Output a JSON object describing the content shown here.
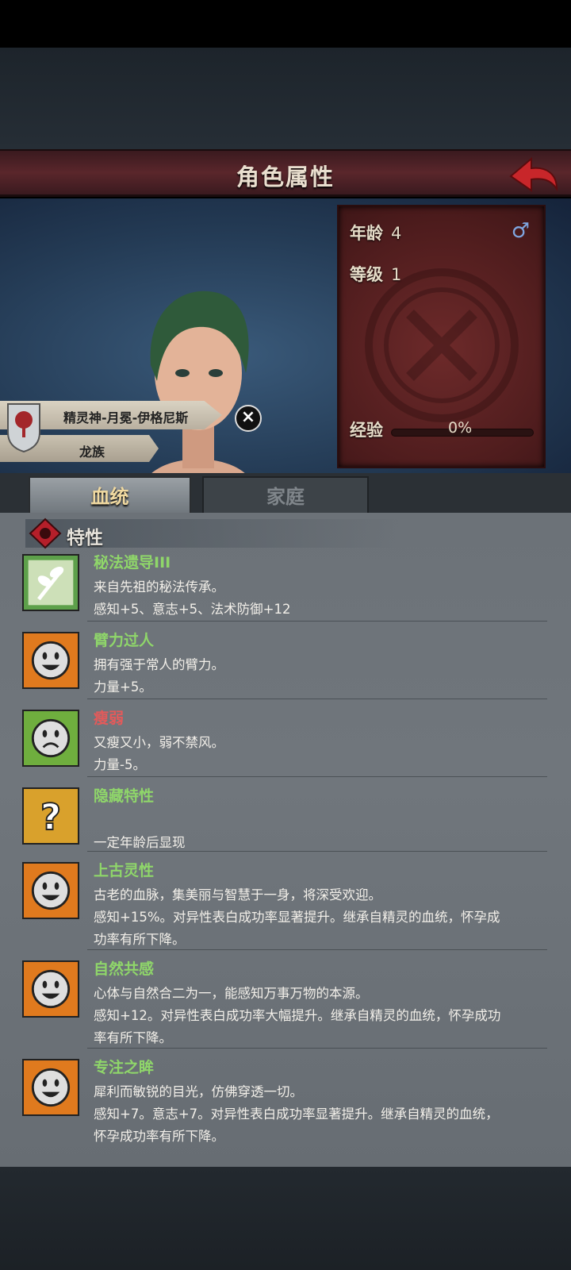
{
  "header": {
    "title": "角色属性"
  },
  "stats": {
    "age_label": "年龄",
    "age_value": "4",
    "gender_symbol": "♂",
    "level_label": "等级",
    "level_value": "1",
    "exp_label": "经验",
    "exp_value": "0%",
    "exp_progress": 0
  },
  "character": {
    "lineage": "精灵神-月冕-伊格尼斯",
    "race": "龙族"
  },
  "tabs": [
    {
      "label": "血统",
      "active": true
    },
    {
      "label": "家庭",
      "active": false
    }
  ],
  "section": {
    "title": "特性"
  },
  "traits": [
    {
      "name": "秘法遗导III",
      "color": "green",
      "icon": "sprout-icon",
      "lines": [
        "来自先祖的秘法传承。",
        "感知+5、意志+5、法术防御+12"
      ]
    },
    {
      "name": "臂力过人",
      "color": "green",
      "icon": "happy-face-icon",
      "lines": [
        "拥有强于常人的臂力。",
        "力量+5。"
      ]
    },
    {
      "name": "瘦弱",
      "color": "red",
      "icon": "sad-face-icon",
      "lines": [
        "又瘦又小，弱不禁风。",
        "力量-5。"
      ]
    },
    {
      "name": "隐藏特性",
      "color": "green",
      "icon": "question-mark-icon",
      "lines": [
        "",
        "一定年龄后显现"
      ]
    },
    {
      "name": "上古灵性",
      "color": "green",
      "icon": "happy-face-icon",
      "lines": [
        "古老的血脉，集美丽与智慧于一身，将深受欢迎。",
        "感知+15%。对异性表白成功率显著提升。继承自精灵的血统，怀孕成",
        "功率有所下降。"
      ]
    },
    {
      "name": "自然共感",
      "color": "green",
      "icon": "happy-face-icon",
      "lines": [
        "心体与自然合二为一，能感知万事万物的本源。",
        "感知+12。对异性表白成功率大幅提升。继承自精灵的血统，怀孕成功",
        "率有所下降。"
      ]
    },
    {
      "name": "专注之眸",
      "color": "green",
      "icon": "happy-face-icon",
      "lines": [
        "犀利而敏锐的目光，仿佛穿透一切。",
        "感知+7。意志+7。对异性表白成功率显著提升。继承自精灵的血统，",
        "怀孕成功率有所下降。"
      ]
    }
  ]
}
